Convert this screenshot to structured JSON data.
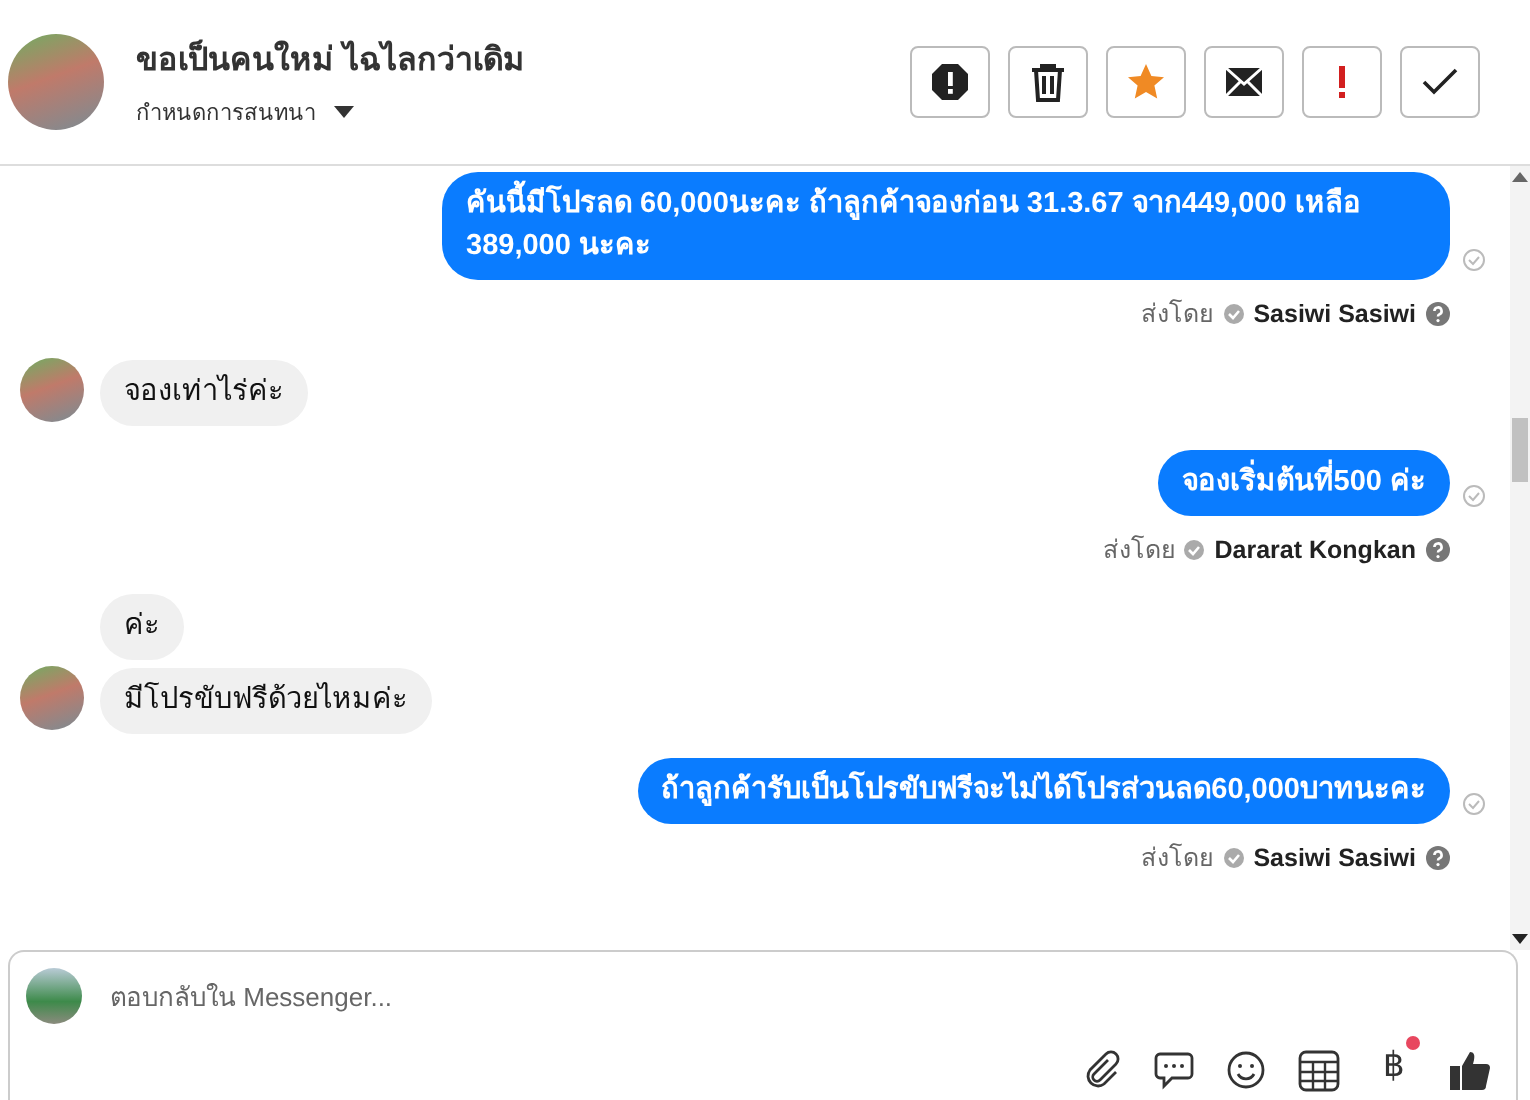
{
  "header": {
    "title": "ขอเป็นคนใหม่ ไฉไลกว่าเดิม",
    "subtitle": "กำหนดการสนทนา",
    "actions": [
      {
        "kind": "report"
      },
      {
        "kind": "delete"
      },
      {
        "kind": "star"
      },
      {
        "kind": "mail"
      },
      {
        "kind": "alert"
      },
      {
        "kind": "done"
      }
    ]
  },
  "messages": [
    {
      "kind": "out",
      "text": "คันนี้มีโปรลด 60,000นะคะ ถ้าลูกค้าจองก่อน 31.3.67 จาก449,000 เหลือ 389,000 นะคะ",
      "sent_by": "ส่งโดย",
      "sender": "Sasiwi Sasiwi"
    },
    {
      "kind": "in",
      "text": "จองเท่าไร่ค่ะ",
      "avatar": true
    },
    {
      "kind": "out",
      "text": "จองเริ่มต้นที่500 ค่ะ",
      "sent_by": "ส่งโดย",
      "sender": "Dararat Kongkan"
    },
    {
      "kind": "in",
      "text": "ค่ะ",
      "avatar": false
    },
    {
      "kind": "in",
      "text": "มีโปรขับฟรีด้วยไหมค่ะ",
      "avatar": true
    },
    {
      "kind": "out",
      "text": "ถ้าลูกค้ารับเป็นโปรขับฟรีจะไม่ได้โปรส่วนลด60,000บาทนะคะ",
      "sent_by": "ส่งโดย",
      "sender": "Sasiwi Sasiwi"
    }
  ],
  "composer": {
    "placeholder": "ตอบกลับใน Messenger...",
    "tools": [
      {
        "kind": "attach"
      },
      {
        "kind": "chat"
      },
      {
        "kind": "emoji"
      },
      {
        "kind": "table"
      },
      {
        "kind": "glyph",
        "glyph": "฿",
        "badge": true
      },
      {
        "kind": "like"
      }
    ]
  }
}
